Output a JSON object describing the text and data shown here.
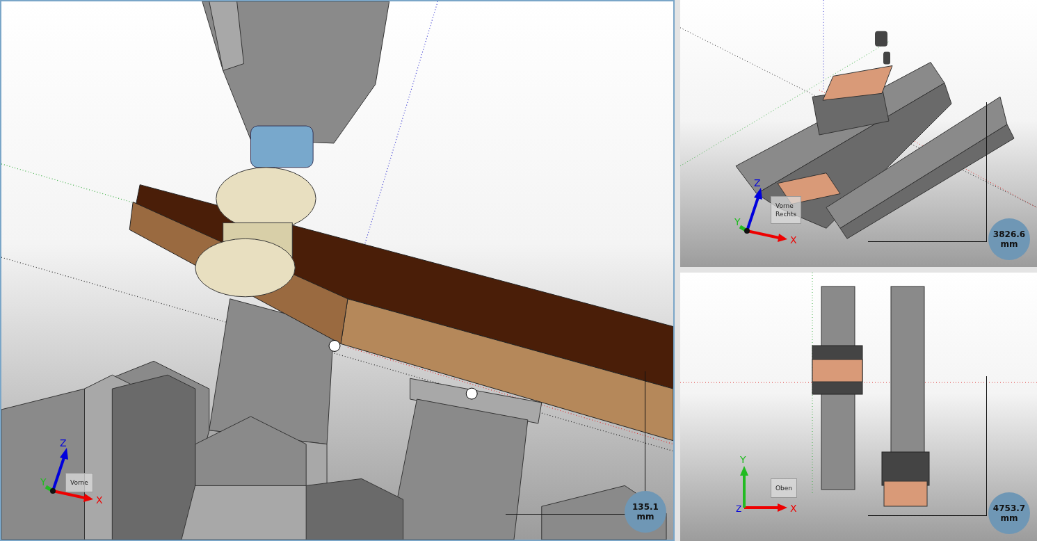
{
  "viewports": [
    {
      "kind": "closeup",
      "axes": {
        "kind": "iso",
        "x": "X",
        "y": "Y",
        "z": "Z"
      },
      "cube_faces": [
        "Vorne"
      ],
      "scale": {
        "value": "135.1",
        "unit": "mm"
      }
    },
    {
      "kind": "iso",
      "axes": {
        "kind": "iso",
        "x": "X",
        "y": "Y",
        "z": "Z"
      },
      "cube_faces": [
        "Vorne",
        "Rechts"
      ],
      "scale": {
        "value": "3826.6",
        "unit": "mm"
      }
    },
    {
      "kind": "top",
      "axes": {
        "kind": "top",
        "x": "X",
        "y": "Y",
        "z": "Z"
      },
      "cube_faces": [
        "Oben"
      ],
      "scale": {
        "value": "4753.7",
        "unit": "mm"
      }
    }
  ]
}
